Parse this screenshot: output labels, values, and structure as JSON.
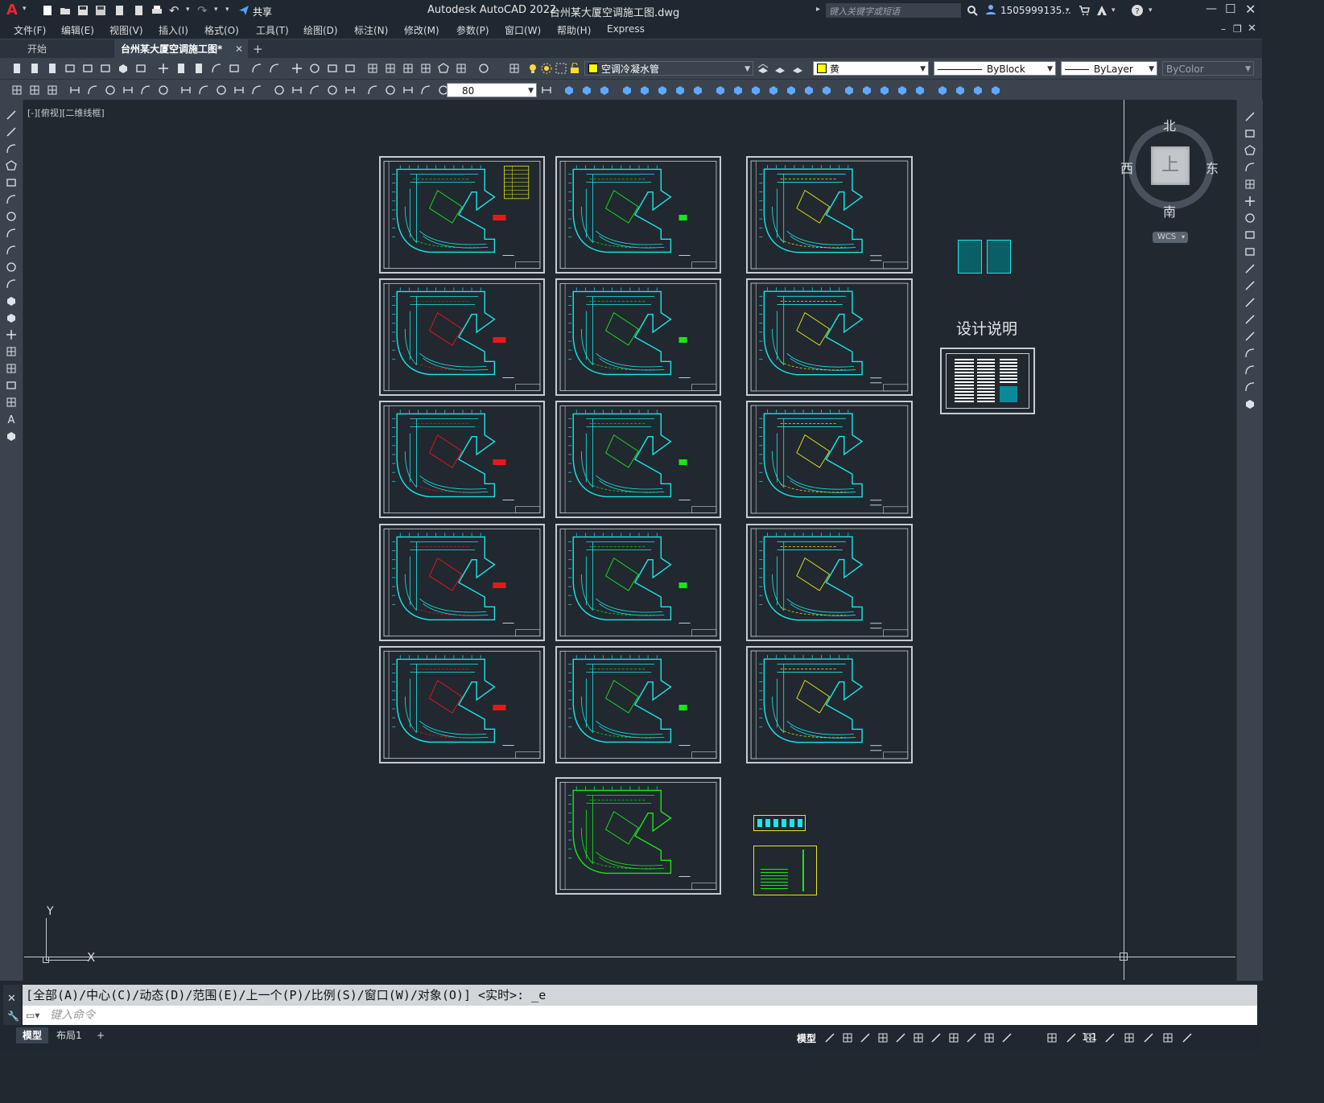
{
  "title": {
    "app": "Autodesk AutoCAD 2022",
    "file": "台州某大厦空调施工图.dwg",
    "share": "共享",
    "search_placeholder": "键入关键字或短语",
    "user": "1505999135...",
    "logo": "A"
  },
  "menu": [
    "文件(F)",
    "编辑(E)",
    "视图(V)",
    "插入(I)",
    "格式(O)",
    "工具(T)",
    "绘图(D)",
    "标注(N)",
    "修改(M)",
    "参数(P)",
    "窗口(W)",
    "帮助(H)",
    "Express"
  ],
  "tabs": {
    "start": "开始",
    "drawing": "台州某大厦空调施工图*",
    "add": "+"
  },
  "toolbar": {
    "layer": "空调冷凝水管",
    "color": "黄",
    "linetype": "ByBlock",
    "lineweight": "ByLayer",
    "plotstyle": "ByColor",
    "scale_value": "80"
  },
  "viewport_label": "[-][俯视][二维线框]",
  "design_note": "设计说明",
  "viewcube": {
    "north": "北",
    "south": "南",
    "east": "东",
    "west": "西",
    "top": "上",
    "wcs": "WCS"
  },
  "ucs": {
    "x": "X",
    "y": "Y"
  },
  "command": {
    "history": "[全部(A)/中心(C)/动态(D)/范围(E)/上一个(P)/比例(S)/窗口(W)/对象(O)] <实时>: _e",
    "placeholder": "键入命令"
  },
  "status": {
    "model_tab": "模型",
    "layout1_tab": "布局1",
    "add": "+",
    "model": "模型",
    "scale": "1:1"
  },
  "colors": {
    "accent_cyan": "#19e6e6",
    "accent_yellow": "#e6e619",
    "accent_red": "#e61919",
    "accent_green": "#19e619",
    "frame": "#c8ccd1"
  }
}
